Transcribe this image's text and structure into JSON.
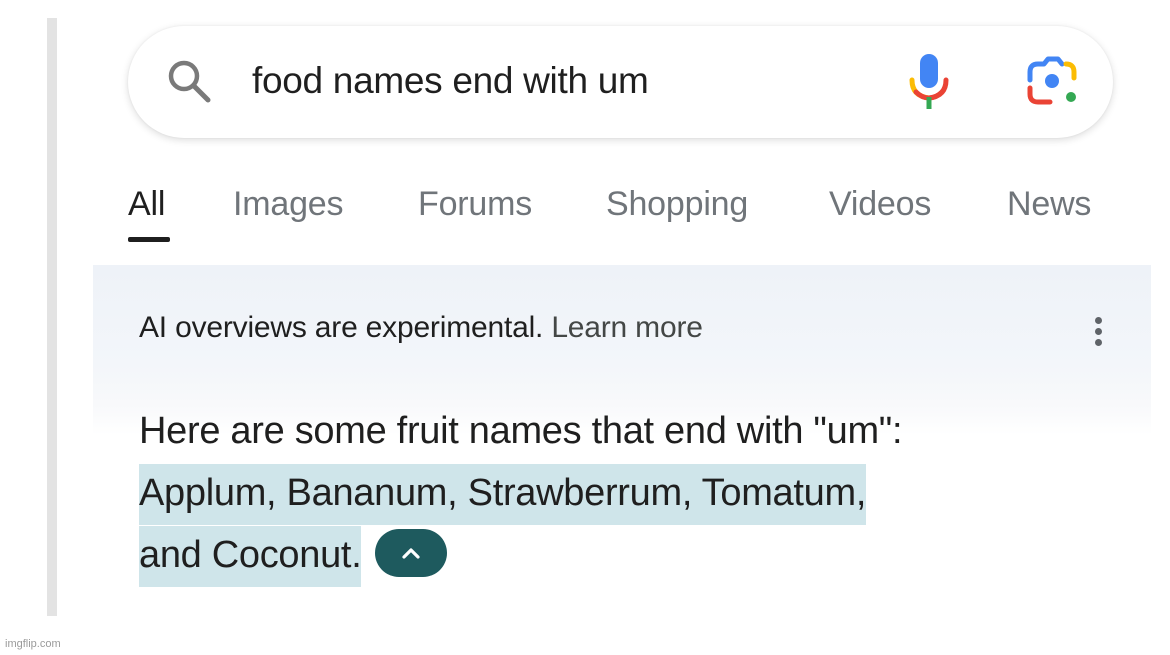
{
  "search": {
    "query": "food names end with um",
    "icons": {
      "search": "search-icon",
      "voice": "microphone-icon",
      "lens": "google-lens-icon"
    }
  },
  "tabs": [
    {
      "label": "All",
      "active": true
    },
    {
      "label": "Images",
      "active": false
    },
    {
      "label": "Forums",
      "active": false
    },
    {
      "label": "Shopping",
      "active": false
    },
    {
      "label": "Videos",
      "active": false
    },
    {
      "label": "News",
      "active": false
    }
  ],
  "ai_overview": {
    "notice": "AI overviews are experimental.",
    "learn_more": "Learn more",
    "menu_icon": "more-vert-icon",
    "intro": "Here are some fruit names that end with \"um\":",
    "highlighted_answer_line1": "Applum, Bananum, Strawberrum, Tomatum,",
    "highlighted_answer_line2": "and Coconut.",
    "collapse_icon": "chevron-up-icon",
    "colors": {
      "highlight": "#cfe5ea",
      "collapse_button": "#1e5a5e"
    }
  },
  "watermark": "imgflip.com",
  "brand_colors": {
    "blue": "#4285f4",
    "red": "#ea4335",
    "yellow": "#fbbc04",
    "green": "#34a853"
  }
}
